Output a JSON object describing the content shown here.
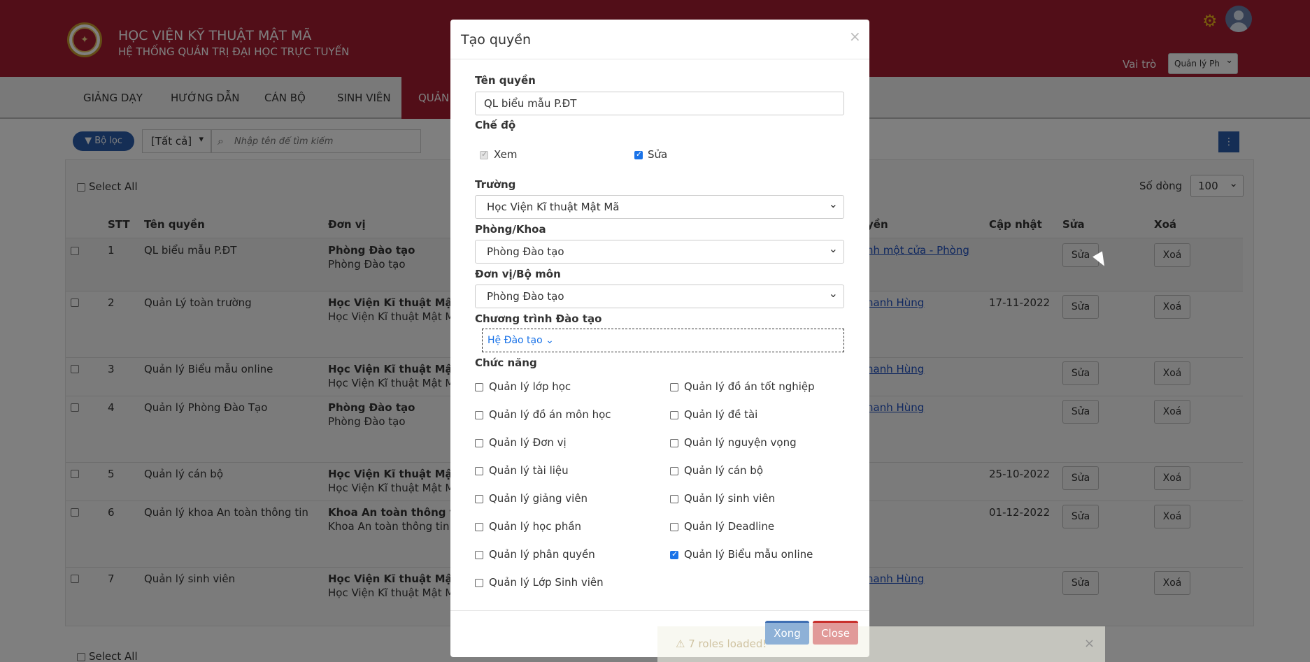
{
  "header": {
    "title": "HỌC VIỆN KỸ THUẬT MẬT MÃ",
    "subtitle": "HỆ THỐNG QUẢN TRỊ ĐẠI HỌC TRỰC TUYẾN",
    "role_label": "Vai trò",
    "role_value": "Quản lý Ph"
  },
  "nav": {
    "items": [
      {
        "label": "GIẢNG DẠY"
      },
      {
        "label": "HƯỚNG DẪN"
      },
      {
        "label": "CÁN BỘ"
      },
      {
        "label": "SINH VIÊN"
      },
      {
        "label": "QUẢN"
      }
    ]
  },
  "toolbar": {
    "filter_label": "Bộ lọc",
    "all_option": "[Tất cả]",
    "search_placeholder": "Nhập tên để tìm kiếm"
  },
  "table": {
    "select_all": "Select All",
    "rows_label": "Số dòng",
    "rows_value": "100",
    "headers": {
      "stt": "STT",
      "name": "Tên quyền",
      "unit": "Đơn vị",
      "user": "yền",
      "updated": "Cập nhật",
      "edit": "Sửa",
      "delete": "Xoá"
    },
    "edit_label": "Sửa",
    "delete_label": "Xoá",
    "rows": [
      {
        "stt": "1",
        "name": "QL biểu mẫu P.ĐT",
        "unit1": "Phòng Đào tạo",
        "unit2": "Phòng Đào tạo",
        "user": "nh một cửa - Phòng",
        "updated": ""
      },
      {
        "stt": "2",
        "name": "Quản Lý toàn trường",
        "unit1": "Học Viện Kĩ thuật Mật Mã",
        "unit2": "Học Viện Kĩ thuật Mật Mã",
        "user": "hanh Hùng",
        "updated": "17-11-2022"
      },
      {
        "stt": "3",
        "name": "Quản lý Biểu mẫu online",
        "unit1": "Học Viện Kĩ thuật Mật Mã",
        "unit2": "Học Viện Kĩ thuật Mật Mã",
        "user": "hanh Hùng",
        "updated": ""
      },
      {
        "stt": "4",
        "name": "Quản lý Phòng Đào Tạo",
        "unit1": "Phòng Đào tạo",
        "unit2": "Phòng Đào tạo",
        "user": "hanh Hùng",
        "updated": ""
      },
      {
        "stt": "5",
        "name": "Quản lý cán bộ",
        "unit1": "Học Viện Kĩ thuật Mật Mã",
        "unit2": "Học Viện Kĩ thuật Mật Mã",
        "user": "",
        "updated": "25-10-2022"
      },
      {
        "stt": "6",
        "name": "Quản lý khoa An toàn thông tin",
        "unit1": "Khoa An toàn thông tin",
        "unit2": "Khoa An toàn thông tin",
        "user": "",
        "updated": "01-12-2022"
      },
      {
        "stt": "7",
        "name": "Quản lý sinh viên",
        "unit1": "Học Viện Kĩ thuật Mật Mã",
        "unit2": "Học Viện Kĩ thuật Mật Mã",
        "user": "hanh Hùng",
        "updated": ""
      }
    ]
  },
  "modal": {
    "title": "Tạo quyền",
    "close_x": "×",
    "name_label": "Tên quyền",
    "name_value": "QL biểu mẫu P.ĐT",
    "mode_label": "Chế độ",
    "mode_view": "Xem",
    "mode_edit": "Sửa",
    "school_label": "Trường",
    "school_value": "Học Viện Kĩ thuật Mật Mã",
    "dept_label": "Phòng/Khoa",
    "dept_value": "Phòng Đào tạo",
    "unit_label": "Đơn vị/Bộ môn",
    "unit_value": "Phòng Đào tạo",
    "program_label": "Chương trình Đào tạo",
    "program_link": "Hệ Đào tạo",
    "functions_label": "Chức năng",
    "functions_left": [
      {
        "label": "Quản lý lớp học",
        "checked": false
      },
      {
        "label": "Quản lý đồ án môn học",
        "checked": false
      },
      {
        "label": "Quản lý Đơn vị",
        "checked": false
      },
      {
        "label": "Quản lý tài liệu",
        "checked": false
      },
      {
        "label": "Quản lý giảng viên",
        "checked": false
      },
      {
        "label": "Quản lý học phần",
        "checked": false
      },
      {
        "label": "Quản lý phân quyền",
        "checked": false
      },
      {
        "label": "Quản lý Lớp Sinh viên",
        "checked": false
      }
    ],
    "functions_right": [
      {
        "label": "Quản lý đồ án tốt nghiệp",
        "checked": false
      },
      {
        "label": "Quản lý đề tài",
        "checked": false
      },
      {
        "label": "Quản lý nguyện vọng",
        "checked": false
      },
      {
        "label": "Quản lý cán bộ",
        "checked": false
      },
      {
        "label": "Quản lý sinh viên",
        "checked": false
      },
      {
        "label": "Quản lý Deadline",
        "checked": false
      },
      {
        "label": "Quản lý Biểu mẫu online",
        "checked": true
      }
    ],
    "ok_label": "Xong",
    "close_label": "Close"
  },
  "toast": {
    "text": "7 roles loaded!",
    "close": "×"
  },
  "colors": {
    "brand": "#a51c30",
    "accent": "#2a5caa",
    "link": "#1f4fbf"
  }
}
